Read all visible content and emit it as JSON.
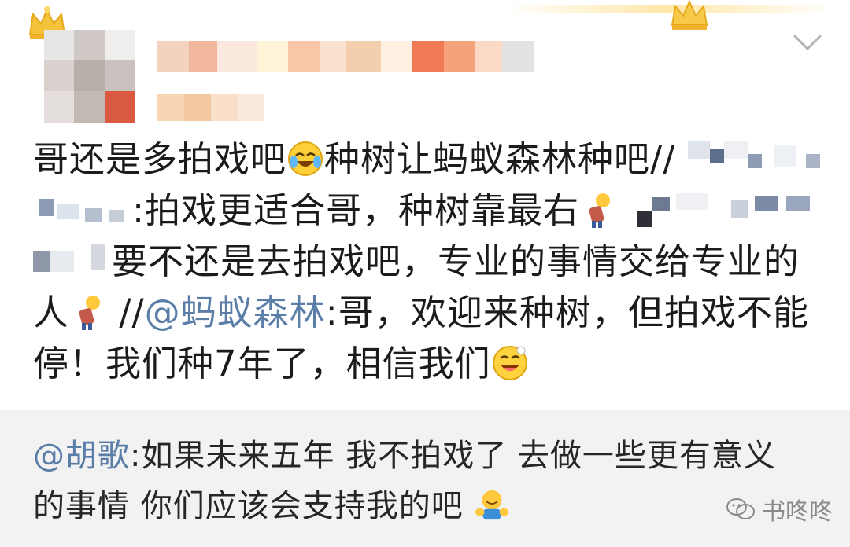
{
  "post": {
    "lines": [
      {
        "segments": [
          {
            "text": "哥还是多拍戏吧"
          },
          {
            "emoji": "laughing-crying-emoji"
          },
          {
            "text": "种树让蚂蚁森林种吧//"
          }
        ]
      },
      {
        "segments": [
          {
            "text": ":拍戏更适合哥，种树靠最右"
          }
        ]
      },
      {
        "segments": [
          {
            "text": "要不还是去拍戏吧，专业的事情交给专业的"
          }
        ]
      },
      {
        "segments": [
          {
            "text": "人"
          },
          {
            "emoji": "bowing-person-emoji"
          },
          {
            "text": " //"
          },
          {
            "mention": "@蚂蚁森林"
          },
          {
            "text": ":哥，欢迎来种树，但拍戏不能"
          }
        ]
      },
      {
        "segments": [
          {
            "text": "停！我们种7年了，相信我们"
          },
          {
            "emoji": "grinning-emoji"
          }
        ]
      }
    ]
  },
  "comment": {
    "mention": "@胡歌",
    "line1_rest": ":如果未来五年 我不拍戏了 去做一些更有意义",
    "line2": "的事情 你们应该会支持我的吧",
    "emoji": "hug-emoji"
  },
  "watermark": {
    "text": "书咚咚",
    "icon": "wechat-icon"
  },
  "colors": {
    "mention": "#5b7ea8",
    "text": "#1b1b1b",
    "comment_bg": "#f2f2f2",
    "crown": "#f5c33b"
  },
  "icons": {
    "chevron": "chevron-down-icon",
    "crown": "crown-icon"
  }
}
